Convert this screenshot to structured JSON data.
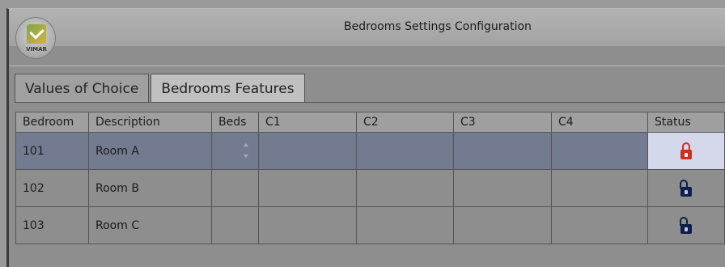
{
  "window": {
    "title": "Bedrooms Settings Configuration"
  },
  "logo": {
    "text": "VIMAR"
  },
  "tabs": [
    {
      "label": "Values of Choice",
      "active": false
    },
    {
      "label": "Bedrooms Features",
      "active": true
    }
  ],
  "table": {
    "columns": [
      "Bedroom",
      "Description",
      "Beds",
      "C1",
      "C2",
      "C3",
      "C4",
      "Status"
    ],
    "rows": [
      {
        "bedroom": "101",
        "description": "Room A",
        "beds": "",
        "c1": "",
        "c2": "",
        "c3": "",
        "c4": "",
        "status_icon": "lock-open-red-icon",
        "selected": true
      },
      {
        "bedroom": "102",
        "description": "Room B",
        "beds": "",
        "c1": "",
        "c2": "",
        "c3": "",
        "c4": "",
        "status_icon": "lock-open-navy-icon",
        "selected": false
      },
      {
        "bedroom": "103",
        "description": "Room C",
        "beds": "",
        "c1": "",
        "c2": "",
        "c3": "",
        "c4": "",
        "status_icon": "lock-open-navy-icon",
        "selected": false
      }
    ]
  },
  "colors": {
    "selected_row": "#737b90",
    "selected_status_cell": "#d3d9eb",
    "lock_red": "#d42b1f",
    "lock_navy": "#0c1f4d"
  }
}
